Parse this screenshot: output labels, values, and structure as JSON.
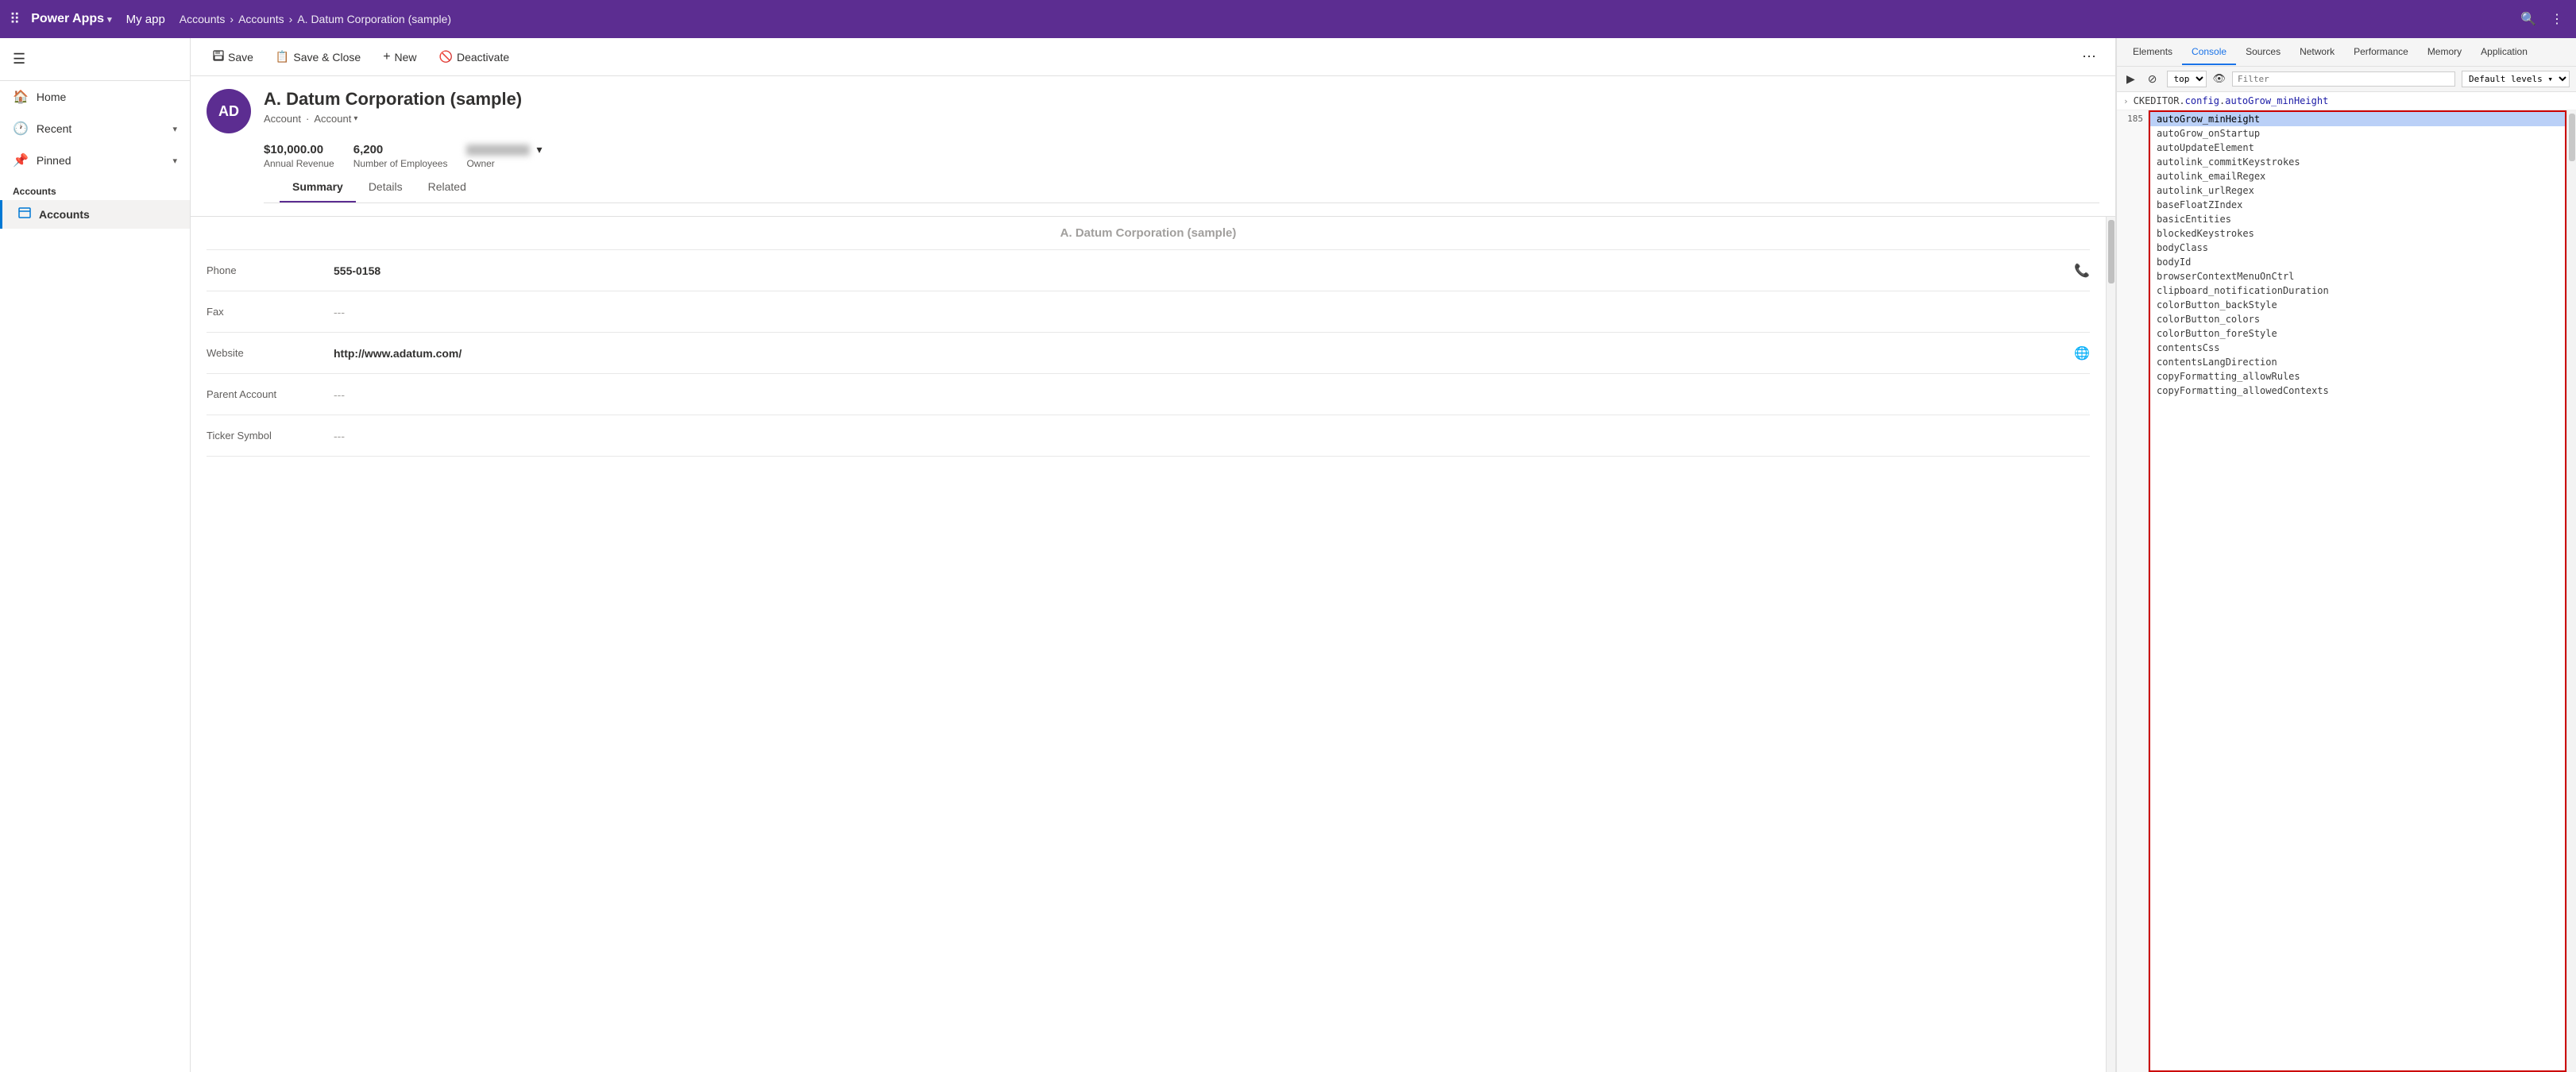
{
  "topnav": {
    "brand": "Power Apps",
    "brand_chevron": "▾",
    "app_name": "My app",
    "breadcrumb": [
      "Accounts",
      "Accounts",
      "A. Datum Corporation (sample)"
    ],
    "breadcrumb_sep": "›"
  },
  "sidebar": {
    "hamburger": "☰",
    "nav_items": [
      {
        "label": "Home",
        "icon": "⌂",
        "has_chevron": false
      },
      {
        "label": "Recent",
        "icon": "🕐",
        "has_chevron": true
      },
      {
        "label": "Pinned",
        "icon": "📌",
        "has_chevron": true
      }
    ],
    "section_label": "Accounts",
    "links": [
      {
        "label": "Accounts",
        "icon": "👤",
        "active": true
      }
    ]
  },
  "toolbar": {
    "save_label": "Save",
    "save_close_label": "Save & Close",
    "new_label": "New",
    "deactivate_label": "Deactivate",
    "save_icon": "💾",
    "save_close_icon": "📋",
    "new_icon": "+",
    "deactivate_icon": "🚫"
  },
  "record": {
    "avatar_initials": "AD",
    "name": "A. Datum Corporation (sample)",
    "type_label1": "Account",
    "dot": "·",
    "type_label2": "Account",
    "annual_revenue_value": "$10,000.00",
    "annual_revenue_label": "Annual Revenue",
    "employees_value": "6,200",
    "employees_label": "Number of Employees",
    "owner_label": "Owner",
    "tabs": [
      "Summary",
      "Details",
      "Related"
    ]
  },
  "form": {
    "title_row_value": "A. Datum Corporation (sample)",
    "rows": [
      {
        "label": "Phone",
        "value": "555-0158",
        "action_icon": "📞",
        "muted": false
      },
      {
        "label": "Fax",
        "value": "---",
        "action_icon": null,
        "muted": true
      },
      {
        "label": "Website",
        "value": "http://www.adatum.com/",
        "action_icon": "🌐",
        "muted": false
      },
      {
        "label": "Parent Account",
        "value": "---",
        "action_icon": null,
        "muted": true
      },
      {
        "label": "Ticker Symbol",
        "value": "---",
        "action_icon": null,
        "muted": true
      }
    ]
  },
  "devtools": {
    "tabs": [
      "Elements",
      "Console",
      "Sources",
      "Network",
      "Performance",
      "Memory",
      "Application"
    ],
    "active_tab": "Console",
    "toolbar": {
      "run_icon": "▶",
      "stop_icon": "⊘",
      "context_select": "top",
      "context_chevron": "▾",
      "eye_icon": "👁",
      "filter_placeholder": "Filter",
      "levels_label": "Default levels",
      "levels_chevron": "▾"
    },
    "console_expression": "CKEDITOR.config.autoGrow_minHeight",
    "console_expression_parts": {
      "obj": "CKEDITOR",
      "dot1": ".",
      "prop1": "config",
      "dot2": ".",
      "prop2": "autoGrow_minHeight"
    },
    "line_number": "185",
    "autocomplete_items": [
      {
        "text": "autoGrow_minHeight",
        "selected": true
      },
      {
        "text": "autoGrow_onStartup",
        "selected": false
      },
      {
        "text": "autoUpdateElement",
        "selected": false
      },
      {
        "text": "autolink_commitKeystrokes",
        "selected": false
      },
      {
        "text": "autolink_emailRegex",
        "selected": false
      },
      {
        "text": "autolink_urlRegex",
        "selected": false
      },
      {
        "text": "baseFloatZIndex",
        "selected": false
      },
      {
        "text": "basicEntities",
        "selected": false
      },
      {
        "text": "blockedKeystrokes",
        "selected": false
      },
      {
        "text": "bodyClass",
        "selected": false
      },
      {
        "text": "bodyId",
        "selected": false
      },
      {
        "text": "browserContextMenuOnCtrl",
        "selected": false
      },
      {
        "text": "clipboard_notificationDuration",
        "selected": false
      },
      {
        "text": "colorButton_backStyle",
        "selected": false
      },
      {
        "text": "colorButton_colors",
        "selected": false
      },
      {
        "text": "colorButton_foreStyle",
        "selected": false
      },
      {
        "text": "contentsCss",
        "selected": false
      },
      {
        "text": "contentsLangDirection",
        "selected": false
      },
      {
        "text": "copyFormatting_allowRules",
        "selected": false
      },
      {
        "text": "copyFormatting_allowedContexts",
        "selected": false
      }
    ]
  }
}
